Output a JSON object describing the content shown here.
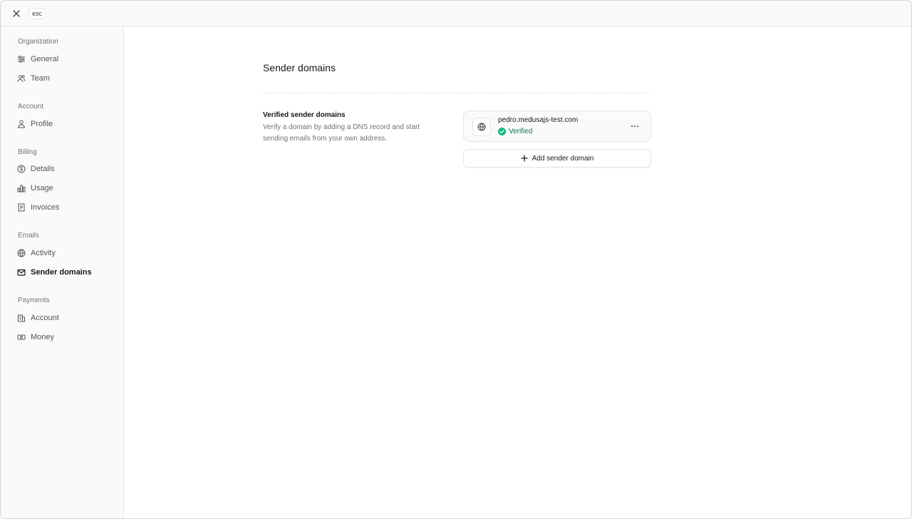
{
  "topbar": {
    "esc_label": "esc"
  },
  "sidebar": {
    "sections": [
      {
        "label": "Organization",
        "items": [
          {
            "label": "General",
            "icon": "sliders-icon"
          },
          {
            "label": "Team",
            "icon": "users-icon"
          }
        ]
      },
      {
        "label": "Account",
        "items": [
          {
            "label": "Profile",
            "icon": "user-icon"
          }
        ]
      },
      {
        "label": "Billing",
        "items": [
          {
            "label": "Details",
            "icon": "dollar-circle-icon"
          },
          {
            "label": "Usage",
            "icon": "bar-chart-icon"
          },
          {
            "label": "Invoices",
            "icon": "receipt-icon"
          }
        ]
      },
      {
        "label": "Emails",
        "items": [
          {
            "label": "Activity",
            "icon": "globe-icon"
          },
          {
            "label": "Sender domains",
            "icon": "envelope-icon",
            "active": true
          }
        ]
      },
      {
        "label": "Payments",
        "items": [
          {
            "label": "Account",
            "icon": "bank-icon"
          },
          {
            "label": "Money",
            "icon": "cash-icon"
          }
        ]
      }
    ]
  },
  "main": {
    "title": "Sender domains",
    "section_title": "Verified sender domains",
    "section_description": "Verify a domain by adding a DNS record and start sending emails from your own address.",
    "domains": [
      {
        "name": "pedro.medusajs-test.com",
        "status": "Verified"
      }
    ],
    "add_button_label": "Add sender domain"
  },
  "colors": {
    "verified": "#10b981",
    "verified_text": "#047857"
  }
}
